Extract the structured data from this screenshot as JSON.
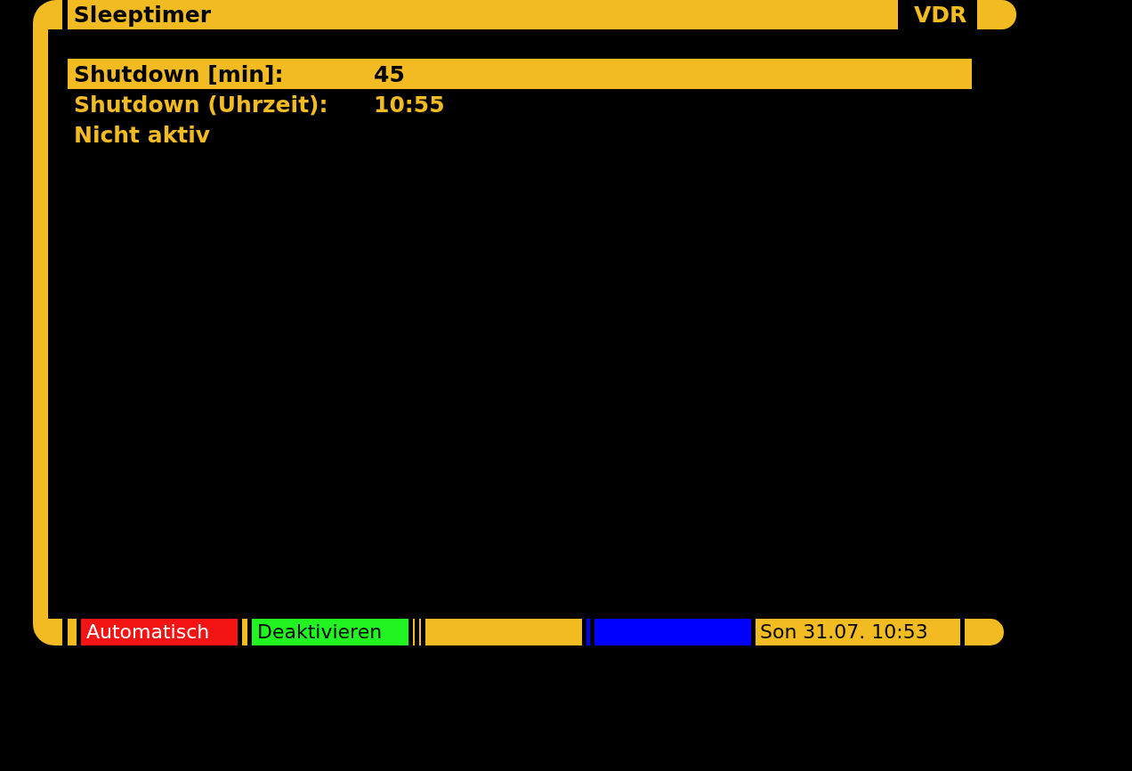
{
  "header": {
    "title": "Sleeptimer",
    "logo": "VDR"
  },
  "menu": {
    "items": [
      {
        "label": "Shutdown [min]:",
        "value": "45",
        "selected": true
      },
      {
        "label": "Shutdown (Uhrzeit):",
        "value": "10:55",
        "selected": false
      },
      {
        "label": "Nicht aktiv",
        "selected": false
      }
    ]
  },
  "color_keys": [
    {
      "label": "Automatisch",
      "color": "#f41414"
    },
    {
      "label": "Deaktivieren",
      "color": "#22f422"
    },
    {
      "color": "#f2bb21"
    },
    {
      "color": "#0000ff"
    }
  ],
  "status": {
    "datetime": "Son 31.07. 10:53"
  }
}
